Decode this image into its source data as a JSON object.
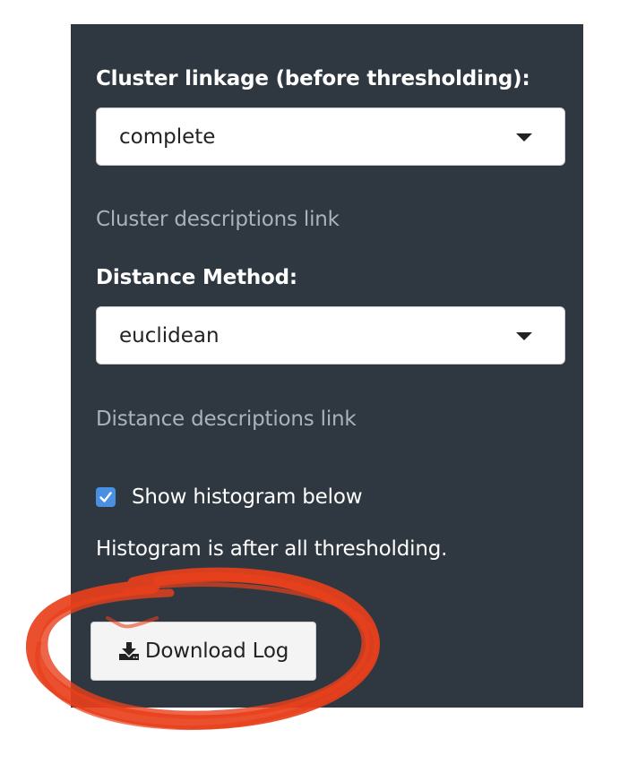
{
  "sidebar": {
    "cluster_linkage": {
      "label": "Cluster linkage (before thresholding):",
      "value": "complete",
      "link": "Cluster descriptions link"
    },
    "distance_method": {
      "label": "Distance Method:",
      "value": "euclidean",
      "link": "Distance descriptions link"
    },
    "histogram": {
      "checkbox_label": "Show histogram below",
      "checked": true,
      "note": "Histogram is after all thresholding."
    },
    "download": {
      "label": "Download Log",
      "icon": "download-icon"
    }
  },
  "colors": {
    "panel_bg": "#2f3840",
    "link_text": "#aab3ba",
    "checkbox": "#4a90e2",
    "annotation": "#e8401c"
  }
}
